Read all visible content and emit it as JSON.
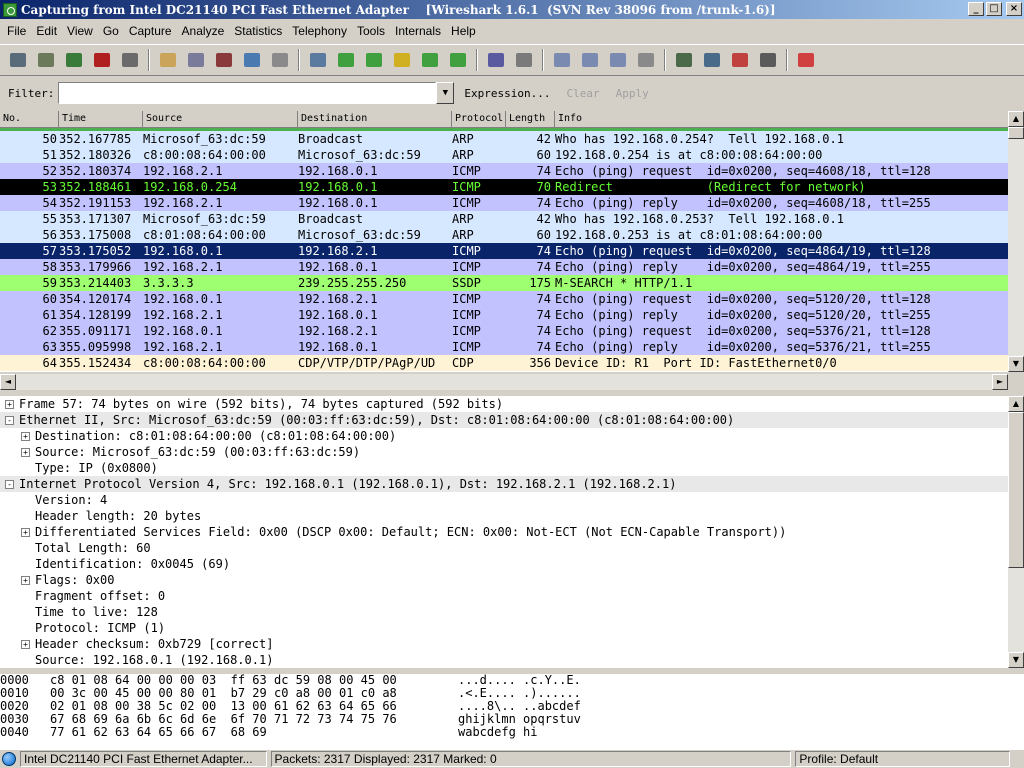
{
  "window": {
    "title": "Capturing from Intel DC21140 PCI Fast Ethernet Adapter    [Wireshark 1.6.1  (SVN Rev 38096 from /trunk-1.6)]",
    "buttons": {
      "minimize": "_",
      "maximize": "□",
      "close": "×"
    }
  },
  "menu": [
    "File",
    "Edit",
    "View",
    "Go",
    "Capture",
    "Analyze",
    "Statistics",
    "Telephony",
    "Tools",
    "Internals",
    "Help"
  ],
  "toolbar": {
    "icons": [
      {
        "name": "interfaces-icon",
        "color": "#5a6b7a"
      },
      {
        "name": "options-icon",
        "color": "#6b7a5a"
      },
      {
        "name": "start-capture-icon",
        "color": "#3a7a3a"
      },
      {
        "name": "stop-capture-icon",
        "color": "#b02020"
      },
      {
        "name": "restart-capture-icon",
        "color": "#6a6a6a"
      },
      {
        "name": "sep",
        "color": ""
      },
      {
        "name": "open-file-icon",
        "color": "#c9a45a"
      },
      {
        "name": "save-file-icon",
        "color": "#7a7a9a"
      },
      {
        "name": "close-file-icon",
        "color": "#8a3a3a"
      },
      {
        "name": "reload-icon",
        "color": "#4a7ab0"
      },
      {
        "name": "print-icon",
        "color": "#8a8a8a"
      },
      {
        "name": "sep",
        "color": ""
      },
      {
        "name": "find-icon",
        "color": "#5a7aa0"
      },
      {
        "name": "go-back-icon",
        "color": "#40a040"
      },
      {
        "name": "go-forward-icon",
        "color": "#40a040"
      },
      {
        "name": "go-to-packet-icon",
        "color": "#d0b020"
      },
      {
        "name": "go-first-icon",
        "color": "#40a040"
      },
      {
        "name": "go-last-icon",
        "color": "#40a040"
      },
      {
        "name": "sep",
        "color": ""
      },
      {
        "name": "colorize-icon",
        "color": "#5a5aa0"
      },
      {
        "name": "auto-scroll-icon",
        "color": "#7a7a7a"
      },
      {
        "name": "sep",
        "color": ""
      },
      {
        "name": "zoom-in-icon",
        "color": "#7a8ab0"
      },
      {
        "name": "zoom-out-icon",
        "color": "#7a8ab0"
      },
      {
        "name": "zoom-normal-icon",
        "color": "#7a8ab0"
      },
      {
        "name": "resize-columns-icon",
        "color": "#8a8a8a"
      },
      {
        "name": "sep",
        "color": ""
      },
      {
        "name": "capture-filters-icon",
        "color": "#4a6a4a"
      },
      {
        "name": "display-filters-icon",
        "color": "#4a6a8a"
      },
      {
        "name": "coloring-rules-icon",
        "color": "#c04040"
      },
      {
        "name": "preferences-icon",
        "color": "#5a5a5a"
      },
      {
        "name": "sep",
        "color": ""
      },
      {
        "name": "help-icon",
        "color": "#d04040"
      }
    ]
  },
  "filter": {
    "label": "Filter:",
    "value": "",
    "expression": "Expression...",
    "clear": "Clear",
    "apply": "Apply"
  },
  "columns": [
    "No.",
    "Time",
    "Source",
    "Destination",
    "Protocol",
    "Length",
    "Info"
  ],
  "packets": [
    {
      "no": "50",
      "time": "352.167785",
      "src": "Microsof_63:dc:59",
      "dst": "Broadcast",
      "proto": "ARP",
      "len": "42",
      "info": "Who has 192.168.0.254?  Tell 192.168.0.1",
      "bg": "#d6e8ff",
      "fg": "#000000"
    },
    {
      "no": "51",
      "time": "352.180326",
      "src": "c8:00:08:64:00:00",
      "dst": "Microsof_63:dc:59",
      "proto": "ARP",
      "len": "60",
      "info": "192.168.0.254 is at c8:00:08:64:00:00",
      "bg": "#d6e8ff",
      "fg": "#000000"
    },
    {
      "no": "52",
      "time": "352.180374",
      "src": "192.168.2.1",
      "dst": "192.168.0.1",
      "proto": "ICMP",
      "len": "74",
      "info": "Echo (ping) request  id=0x0200, seq=4608/18, ttl=128",
      "bg": "#c2c2ff",
      "fg": "#000000"
    },
    {
      "no": "53",
      "time": "352.188461",
      "src": "192.168.0.254",
      "dst": "192.168.0.1",
      "proto": "ICMP",
      "len": "70",
      "info": "Redirect             (Redirect for network)",
      "bg": "#000000",
      "fg": "#66ff33"
    },
    {
      "no": "54",
      "time": "352.191153",
      "src": "192.168.2.1",
      "dst": "192.168.0.1",
      "proto": "ICMP",
      "len": "74",
      "info": "Echo (ping) reply    id=0x0200, seq=4608/18, ttl=255",
      "bg": "#c2c2ff",
      "fg": "#000000"
    },
    {
      "no": "55",
      "time": "353.171307",
      "src": "Microsof_63:dc:59",
      "dst": "Broadcast",
      "proto": "ARP",
      "len": "42",
      "info": "Who has 192.168.0.253?  Tell 192.168.0.1",
      "bg": "#d6e8ff",
      "fg": "#000000"
    },
    {
      "no": "56",
      "time": "353.175008",
      "src": "c8:01:08:64:00:00",
      "dst": "Microsof_63:dc:59",
      "proto": "ARP",
      "len": "60",
      "info": "192.168.0.253 is at c8:01:08:64:00:00",
      "bg": "#d6e8ff",
      "fg": "#000000"
    },
    {
      "no": "57",
      "time": "353.175052",
      "src": "192.168.0.1",
      "dst": "192.168.2.1",
      "proto": "ICMP",
      "len": "74",
      "info": "Echo (ping) request  id=0x0200, seq=4864/19, ttl=128",
      "bg": "#0a246a",
      "fg": "#ffffff"
    },
    {
      "no": "58",
      "time": "353.179966",
      "src": "192.168.2.1",
      "dst": "192.168.0.1",
      "proto": "ICMP",
      "len": "74",
      "info": "Echo (ping) reply    id=0x0200, seq=4864/19, ttl=255",
      "bg": "#c2c2ff",
      "fg": "#000000"
    },
    {
      "no": "59",
      "time": "353.214403",
      "src": "3.3.3.3",
      "dst": "239.255.255.250",
      "proto": "SSDP",
      "len": "175",
      "info": "M-SEARCH * HTTP/1.1",
      "bg": "#9eff70",
      "fg": "#000000"
    },
    {
      "no": "60",
      "time": "354.120174",
      "src": "192.168.0.1",
      "dst": "192.168.2.1",
      "proto": "ICMP",
      "len": "74",
      "info": "Echo (ping) request  id=0x0200, seq=5120/20, ttl=128",
      "bg": "#c2c2ff",
      "fg": "#000000"
    },
    {
      "no": "61",
      "time": "354.128199",
      "src": "192.168.2.1",
      "dst": "192.168.0.1",
      "proto": "ICMP",
      "len": "74",
      "info": "Echo (ping) reply    id=0x0200, seq=5120/20, ttl=255",
      "bg": "#c2c2ff",
      "fg": "#000000"
    },
    {
      "no": "62",
      "time": "355.091171",
      "src": "192.168.0.1",
      "dst": "192.168.2.1",
      "proto": "ICMP",
      "len": "74",
      "info": "Echo (ping) request  id=0x0200, seq=5376/21, ttl=128",
      "bg": "#c2c2ff",
      "fg": "#000000"
    },
    {
      "no": "63",
      "time": "355.095998",
      "src": "192.168.2.1",
      "dst": "192.168.0.1",
      "proto": "ICMP",
      "len": "74",
      "info": "Echo (ping) reply    id=0x0200, seq=5376/21, ttl=255",
      "bg": "#c2c2ff",
      "fg": "#000000"
    },
    {
      "no": "64",
      "time": "355.152434",
      "src": "c8:00:08:64:00:00",
      "dst": "CDP/VTP/DTP/PAgP/UD",
      "proto": "CDP",
      "len": "356",
      "info": "Device ID: R1  Port ID: FastEthernet0/0",
      "bg": "#fff3d6",
      "fg": "#000000"
    }
  ],
  "details": [
    {
      "indent": 0,
      "exp": "+",
      "text": "Frame 57: 74 bytes on wire (592 bits), 74 bytes captured (592 bits)",
      "hl": false
    },
    {
      "indent": 0,
      "exp": "-",
      "text": "Ethernet II, Src: Microsof_63:dc:59 (00:03:ff:63:dc:59), Dst: c8:01:08:64:00:00 (c8:01:08:64:00:00)",
      "hl": true
    },
    {
      "indent": 1,
      "exp": "+",
      "text": "Destination: c8:01:08:64:00:00 (c8:01:08:64:00:00)",
      "hl": false
    },
    {
      "indent": 1,
      "exp": "+",
      "text": "Source: Microsof_63:dc:59 (00:03:ff:63:dc:59)",
      "hl": false
    },
    {
      "indent": 1,
      "exp": "",
      "text": "Type: IP (0x0800)",
      "hl": false
    },
    {
      "indent": 0,
      "exp": "-",
      "text": "Internet Protocol Version 4, Src: 192.168.0.1 (192.168.0.1), Dst: 192.168.2.1 (192.168.2.1)",
      "hl": true
    },
    {
      "indent": 1,
      "exp": "",
      "text": "Version: 4",
      "hl": false
    },
    {
      "indent": 1,
      "exp": "",
      "text": "Header length: 20 bytes",
      "hl": false
    },
    {
      "indent": 1,
      "exp": "+",
      "text": "Differentiated Services Field: 0x00 (DSCP 0x00: Default; ECN: 0x00: Not-ECT (Not ECN-Capable Transport))",
      "hl": false
    },
    {
      "indent": 1,
      "exp": "",
      "text": "Total Length: 60",
      "hl": false
    },
    {
      "indent": 1,
      "exp": "",
      "text": "Identification: 0x0045 (69)",
      "hl": false
    },
    {
      "indent": 1,
      "exp": "+",
      "text": "Flags: 0x00",
      "hl": false
    },
    {
      "indent": 1,
      "exp": "",
      "text": "Fragment offset: 0",
      "hl": false
    },
    {
      "indent": 1,
      "exp": "",
      "text": "Time to live: 128",
      "hl": false
    },
    {
      "indent": 1,
      "exp": "",
      "text": "Protocol: ICMP (1)",
      "hl": false
    },
    {
      "indent": 1,
      "exp": "+",
      "text": "Header checksum: 0xb729 [correct]",
      "hl": false
    },
    {
      "indent": 1,
      "exp": "",
      "text": "Source: 192.168.0.1 (192.168.0.1)",
      "hl": false
    }
  ],
  "hex": [
    {
      "off": "0000",
      "bytes": "c8 01 08 64 00 00 00 03  ff 63 dc 59 08 00 45 00",
      "ascii": "...d.... .c.Y..E."
    },
    {
      "off": "0010",
      "bytes": "00 3c 00 45 00 00 80 01  b7 29 c0 a8 00 01 c0 a8",
      "ascii": ".<.E.... .)......"
    },
    {
      "off": "0020",
      "bytes": "02 01 08 00 38 5c 02 00  13 00 61 62 63 64 65 66",
      "ascii": "....8\\.. ..abcdef"
    },
    {
      "off": "0030",
      "bytes": "67 68 69 6a 6b 6c 6d 6e  6f 70 71 72 73 74 75 76",
      "ascii": "ghijklmn opqrstuv"
    },
    {
      "off": "0040",
      "bytes": "77 61 62 63 64 65 66 67  68 69",
      "ascii": "wabcdefg hi"
    }
  ],
  "status": {
    "interface": "Intel DC21140 PCI Fast Ethernet Adapter...",
    "packets": "Packets: 2317 Displayed: 2317 Marked: 0",
    "profile": "Profile: Default"
  }
}
